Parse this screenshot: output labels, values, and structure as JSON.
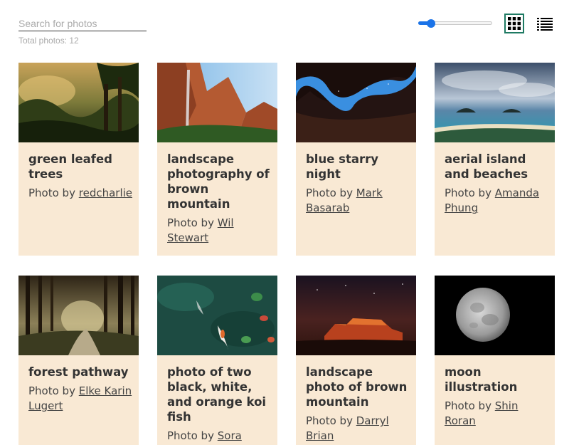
{
  "search": {
    "placeholder": "Search for photos",
    "value": ""
  },
  "total_label": "Total photos: 12",
  "thumbnail_size": {
    "level": 0.12
  },
  "view_modes": [
    {
      "name": "grid",
      "icon": "grid-icon",
      "active": true
    },
    {
      "name": "list",
      "icon": "list-icon",
      "active": false
    }
  ],
  "colors": {
    "card_bg": "#f9e9d4",
    "accent": "#1a73e8",
    "grid_border": "#1e7a63"
  },
  "photos": [
    {
      "title": "green leafed trees",
      "photo_by": "Photo by",
      "author": "redcharlie"
    },
    {
      "title": "landscape photography of brown mountain",
      "photo_by": "Photo by",
      "author": "Wil Stewart"
    },
    {
      "title": "blue starry night",
      "photo_by": "Photo by",
      "author": "Mark Basarab"
    },
    {
      "title": "aerial island and beaches",
      "photo_by": "Photo by",
      "author": "Amanda Phung"
    },
    {
      "title": "forest pathway",
      "photo_by": "Photo by",
      "author": "Elke Karin Lugert"
    },
    {
      "title": "photo of two black, white, and orange koi fish",
      "photo_by": "Photo by",
      "author": "Sora"
    },
    {
      "title": "landscape photo of brown mountain",
      "photo_by": "Photo by",
      "author": "Darryl Brian"
    },
    {
      "title": "moon illustration",
      "photo_by": "Photo by",
      "author": "Shin Roran"
    }
  ]
}
